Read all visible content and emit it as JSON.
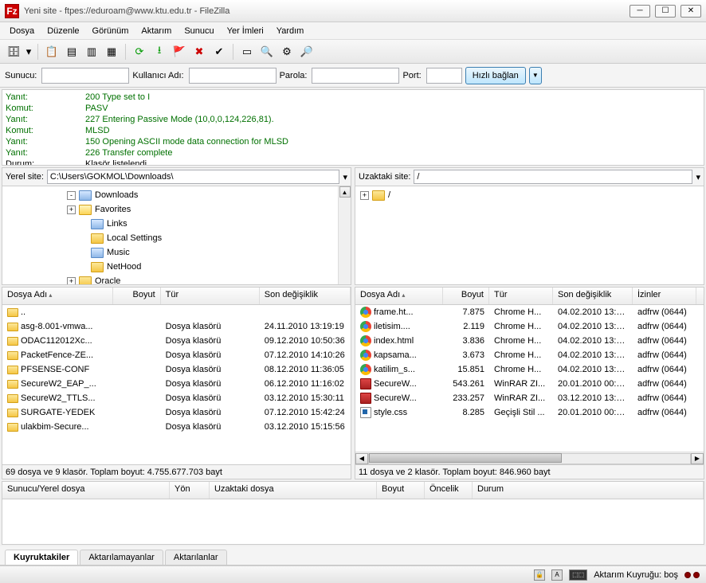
{
  "title": "Yeni site - ftpes://eduroam@www.ktu.edu.tr - FileZilla",
  "menu": [
    "Dosya",
    "Düzenle",
    "Görünüm",
    "Aktarım",
    "Sunucu",
    "Yer İmleri",
    "Yardım"
  ],
  "quickconnect": {
    "host_label": "Sunucu:",
    "user_label": "Kullanıcı Adı:",
    "pass_label": "Parola:",
    "port_label": "Port:",
    "button": "Hızlı bağlan"
  },
  "log": [
    {
      "key": "Yanıt:",
      "val": "200 Type set to I",
      "type": "resp"
    },
    {
      "key": "Komut:",
      "val": "PASV",
      "type": "resp"
    },
    {
      "key": "Yanıt:",
      "val": "227 Entering Passive Mode (10,0,0,124,226,81).",
      "type": "resp"
    },
    {
      "key": "Komut:",
      "val": "MLSD",
      "type": "resp"
    },
    {
      "key": "Yanıt:",
      "val": "150 Opening ASCII mode data connection for MLSD",
      "type": "resp"
    },
    {
      "key": "Yanıt:",
      "val": "226 Transfer complete",
      "type": "resp"
    },
    {
      "key": "Durum:",
      "val": "Klasör listelendi",
      "type": "status"
    }
  ],
  "local": {
    "site_label": "Yerel site:",
    "path": "C:\\Users\\GOKMOL\\Downloads\\",
    "tree": [
      {
        "name": "Downloads",
        "exp": "-",
        "indent": 5,
        "folder": "special"
      },
      {
        "name": "Favorites",
        "exp": "+",
        "indent": 5,
        "folder": "star"
      },
      {
        "name": "Links",
        "exp": "",
        "indent": 6,
        "folder": "special"
      },
      {
        "name": "Local Settings",
        "exp": "",
        "indent": 6,
        "folder": "normal"
      },
      {
        "name": "Music",
        "exp": "",
        "indent": 6,
        "folder": "special"
      },
      {
        "name": "NetHood",
        "exp": "",
        "indent": 6,
        "folder": "normal"
      },
      {
        "name": "Oracle",
        "exp": "+",
        "indent": 5,
        "folder": "normal"
      }
    ],
    "columns": {
      "name": "Dosya Adı",
      "size": "Boyut",
      "type": "Tür",
      "modified": "Son değişiklik"
    },
    "col_widths": {
      "name": 140,
      "size": 60,
      "type": 125,
      "modified": 115
    },
    "files": [
      {
        "name": "..",
        "size": "",
        "type": "",
        "modified": "",
        "icon": "folder"
      },
      {
        "name": "asg-8.001-vmwa...",
        "size": "",
        "type": "Dosya klasörü",
        "modified": "24.11.2010 13:19:19",
        "icon": "folder"
      },
      {
        "name": "ODAC112012Xc...",
        "size": "",
        "type": "Dosya klasörü",
        "modified": "09.12.2010 10:50:36",
        "icon": "folder"
      },
      {
        "name": "PacketFence-ZE...",
        "size": "",
        "type": "Dosya klasörü",
        "modified": "07.12.2010 14:10:26",
        "icon": "folder"
      },
      {
        "name": "PFSENSE-CONF",
        "size": "",
        "type": "Dosya klasörü",
        "modified": "08.12.2010 11:36:05",
        "icon": "folder"
      },
      {
        "name": "SecureW2_EAP_...",
        "size": "",
        "type": "Dosya klasörü",
        "modified": "06.12.2010 11:16:02",
        "icon": "folder"
      },
      {
        "name": "SecureW2_TTLS...",
        "size": "",
        "type": "Dosya klasörü",
        "modified": "03.12.2010 15:30:11",
        "icon": "folder"
      },
      {
        "name": "SURGATE-YEDEK",
        "size": "",
        "type": "Dosya klasörü",
        "modified": "07.12.2010 15:42:24",
        "icon": "folder"
      },
      {
        "name": "ulakbim-Secure...",
        "size": "",
        "type": "Dosya klasörü",
        "modified": "03.12.2010 15:15:56",
        "icon": "folder"
      }
    ],
    "status": "69 dosya ve 9 klasör. Toplam boyut: 4.755.677.703 bayt"
  },
  "remote": {
    "site_label": "Uzaktaki site:",
    "path": "/",
    "tree": [
      {
        "name": "/",
        "exp": "+",
        "indent": 0,
        "folder": "normal"
      }
    ],
    "columns": {
      "name": "Dosya Adı",
      "size": "Boyut",
      "type": "Tür",
      "modified": "Son değişiklik",
      "perms": "İzinler"
    },
    "col_widths": {
      "name": 110,
      "size": 58,
      "type": 80,
      "modified": 100,
      "perms": 80
    },
    "files": [
      {
        "name": "frame.ht...",
        "size": "7.875",
        "type": "Chrome H...",
        "modified": "04.02.2010 13:3...",
        "perms": "adfrw (0644)",
        "icon": "chrome"
      },
      {
        "name": "iletisim....",
        "size": "2.119",
        "type": "Chrome H...",
        "modified": "04.02.2010 13:3...",
        "perms": "adfrw (0644)",
        "icon": "chrome"
      },
      {
        "name": "index.html",
        "size": "3.836",
        "type": "Chrome H...",
        "modified": "04.02.2010 13:3...",
        "perms": "adfrw (0644)",
        "icon": "chrome"
      },
      {
        "name": "kapsama...",
        "size": "3.673",
        "type": "Chrome H...",
        "modified": "04.02.2010 13:3...",
        "perms": "adfrw (0644)",
        "icon": "chrome"
      },
      {
        "name": "katilim_s...",
        "size": "15.851",
        "type": "Chrome H...",
        "modified": "04.02.2010 13:3...",
        "perms": "adfrw (0644)",
        "icon": "chrome"
      },
      {
        "name": "SecureW...",
        "size": "543.261",
        "type": "WinRAR ZI...",
        "modified": "20.01.2010 00:3...",
        "perms": "adfrw (0644)",
        "icon": "rar"
      },
      {
        "name": "SecureW...",
        "size": "233.257",
        "type": "WinRAR ZI...",
        "modified": "03.12.2010 13:0...",
        "perms": "adfrw (0644)",
        "icon": "rar"
      },
      {
        "name": "style.css",
        "size": "8.285",
        "type": "Geçişli Stil ...",
        "modified": "20.01.2010 00:3...",
        "perms": "adfrw (0644)",
        "icon": "css"
      }
    ],
    "status": "11 dosya ve 2 klasör. Toplam boyut: 846.960 bayt"
  },
  "queue": {
    "columns": {
      "server": "Sunucu/Yerel dosya",
      "dir": "Yön",
      "remote": "Uzaktaki dosya",
      "size": "Boyut",
      "priority": "Öncelik",
      "status": "Durum"
    }
  },
  "tabs": [
    "Kuyruktakiler",
    "Aktarılamayanlar",
    "Aktarılanlar"
  ],
  "bottom": {
    "queue_label": "Aktarım Kuyruğu: boş"
  }
}
